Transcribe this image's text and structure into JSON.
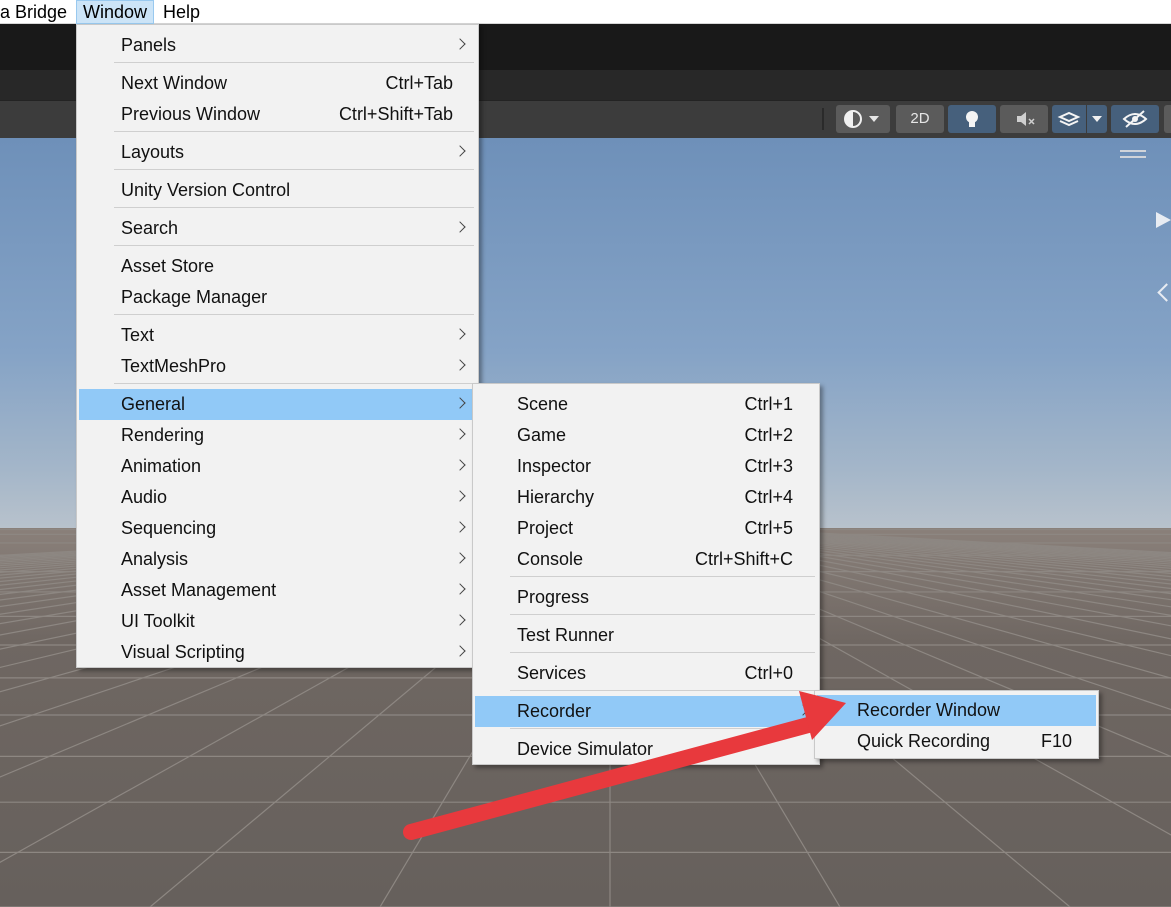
{
  "menubar": {
    "items": [
      "a Bridge",
      "Window",
      "Help"
    ]
  },
  "toolbar": {
    "view_2d_label": "2D",
    "icons": [
      "shading-mode-icon",
      "lighting-toggle-icon",
      "audio-mute-icon",
      "effects-layers-icon",
      "scene-visibility-icon"
    ]
  },
  "window_menu": {
    "items": [
      {
        "label": "Panels",
        "submenu": true
      },
      {
        "label": "Next Window",
        "shortcut": "Ctrl+Tab"
      },
      {
        "label": "Previous Window",
        "shortcut": "Ctrl+Shift+Tab"
      },
      {
        "label": "Layouts",
        "submenu": true
      },
      {
        "label": "Unity Version Control"
      },
      {
        "label": "Search",
        "submenu": true
      },
      {
        "label": "Asset Store"
      },
      {
        "label": "Package Manager"
      },
      {
        "label": "Text",
        "submenu": true
      },
      {
        "label": "TextMeshPro",
        "submenu": true
      },
      {
        "label": "General",
        "submenu": true,
        "highlighted": true
      },
      {
        "label": "Rendering",
        "submenu": true
      },
      {
        "label": "Animation",
        "submenu": true
      },
      {
        "label": "Audio",
        "submenu": true
      },
      {
        "label": "Sequencing",
        "submenu": true
      },
      {
        "label": "Analysis",
        "submenu": true
      },
      {
        "label": "Asset Management",
        "submenu": true
      },
      {
        "label": "UI Toolkit",
        "submenu": true
      },
      {
        "label": "Visual Scripting",
        "submenu": true
      }
    ]
  },
  "general_menu": {
    "items": [
      {
        "label": "Scene",
        "shortcut": "Ctrl+1"
      },
      {
        "label": "Game",
        "shortcut": "Ctrl+2"
      },
      {
        "label": "Inspector",
        "shortcut": "Ctrl+3"
      },
      {
        "label": "Hierarchy",
        "shortcut": "Ctrl+4"
      },
      {
        "label": "Project",
        "shortcut": "Ctrl+5"
      },
      {
        "label": "Console",
        "shortcut": "Ctrl+Shift+C"
      },
      {
        "label": "Progress"
      },
      {
        "label": "Test Runner"
      },
      {
        "label": "Services",
        "shortcut": "Ctrl+0"
      },
      {
        "label": "Recorder",
        "submenu": true,
        "highlighted": true
      },
      {
        "label": "Device Simulator"
      }
    ]
  },
  "recorder_menu": {
    "items": [
      {
        "label": "Recorder Window",
        "highlighted": true
      },
      {
        "label": "Quick Recording",
        "shortcut": "F10"
      }
    ]
  },
  "colors": {
    "menu_bg": "#f2f2f2",
    "highlight": "#91c9f7",
    "annotation_arrow": "#e8393d"
  }
}
